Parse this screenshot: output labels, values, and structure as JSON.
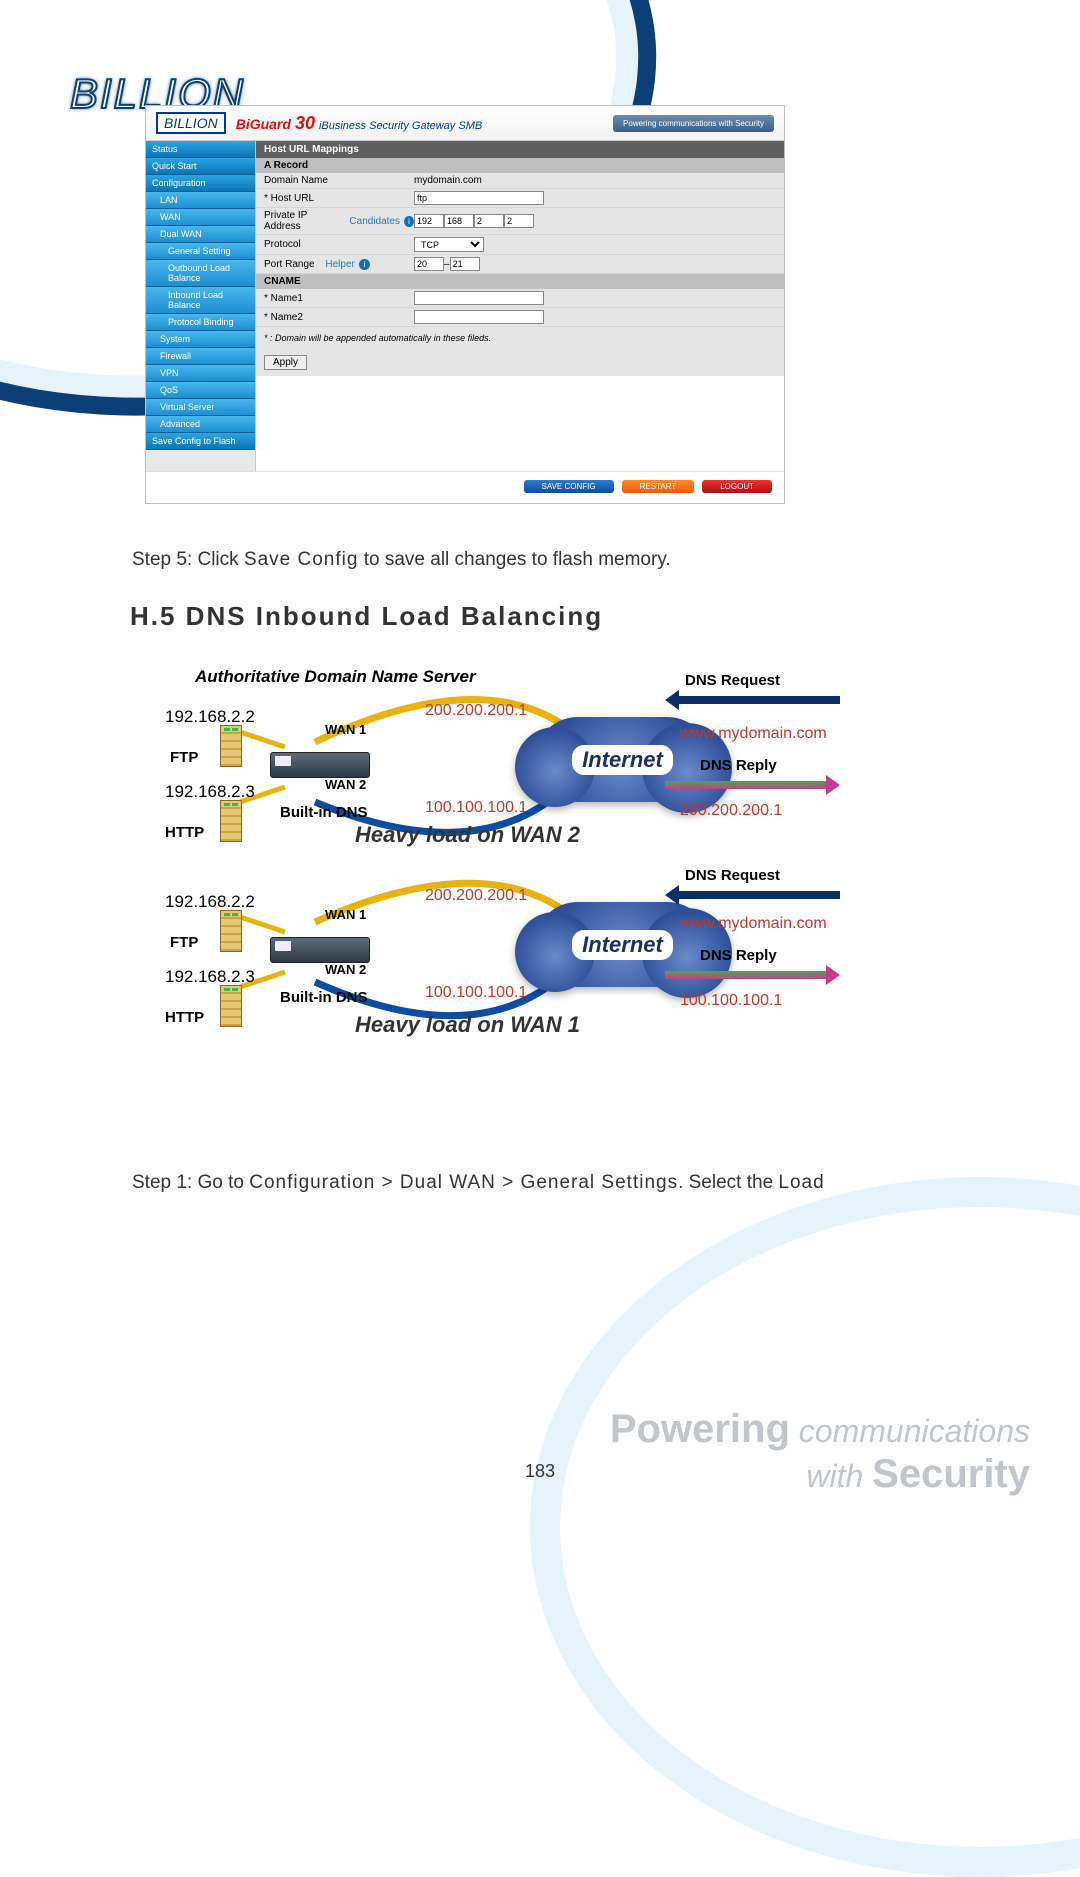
{
  "brand": "BILLION",
  "footer_tag_line1": "Powering",
  "footer_tag_line1b": "communications",
  "footer_tag_line2a": "with",
  "footer_tag_line2b": "Security",
  "page_number": "183",
  "admin": {
    "logo": "BILLION",
    "product_bg": "BiGuard",
    "product_num": "30",
    "product_sub": "iBusiness Security Gateway SMB",
    "header_tag": "Powering communications with Security",
    "nav": [
      {
        "label": "Status"
      },
      {
        "label": "Quick Start"
      },
      {
        "label": "Configuration"
      },
      {
        "label": "LAN",
        "sub": true
      },
      {
        "label": "WAN",
        "sub": true
      },
      {
        "label": "Dual WAN",
        "sub": true
      },
      {
        "label": "General Setting",
        "sub": true,
        "deep": true
      },
      {
        "label": "Outbound Load Balance",
        "sub": true,
        "deep": true
      },
      {
        "label": "Inbound Load Balance",
        "sub": true,
        "deep": true
      },
      {
        "label": "Protocol Binding",
        "sub": true,
        "deep": true
      },
      {
        "label": "System",
        "sub": true
      },
      {
        "label": "Firewall",
        "sub": true
      },
      {
        "label": "VPN",
        "sub": true
      },
      {
        "label": "QoS",
        "sub": true
      },
      {
        "label": "Virtual Server",
        "sub": true
      },
      {
        "label": "Advanced",
        "sub": true
      },
      {
        "label": "Save Config to Flash"
      }
    ],
    "section_title": "Host URL Mappings",
    "group_a": "A Record",
    "rows": {
      "domain_lbl": "Domain Name",
      "domain_val": "mydomain.com",
      "host_lbl": "* Host URL",
      "host_val": "ftp",
      "ip_lbl": "Private IP Address",
      "ip_link": "Candidates",
      "ip_a": "192",
      "ip_b": "168",
      "ip_c": "2",
      "ip_d": "2",
      "proto_lbl": "Protocol",
      "proto_val": "TCP",
      "port_lbl": "Port Range",
      "port_link": "Helper",
      "port_a": "20",
      "port_b": "21"
    },
    "group_b": "CNAME",
    "cname1_lbl": "* Name1",
    "cname2_lbl": "* Name2",
    "note": "* : Domain will be appended automatically in these fileds.",
    "apply": "Apply",
    "footer_btns": {
      "save": "SAVE CONFIG",
      "restart": "RESTART",
      "logout": "LOGOUT"
    }
  },
  "step5_a": "Step 5: Click ",
  "step5_kw": "Save Config",
  "step5_b": " to save all changes to flash memory.",
  "section_heading": "H.5   DNS Inbound Load Balancing",
  "diagram": {
    "auth_title": "Authoritative Domain Name Server",
    "ftp": "FTP",
    "http": "HTTP",
    "wan1": "WAN 1",
    "wan2": "WAN 2",
    "builtin": "Built-in DNS",
    "internet": "Internet",
    "dns_req": "DNS Request",
    "dns_reply": "DNS Reply",
    "domain": "www.mydomain.com",
    "ip_wan1": "200.200.200.1",
    "ip_wan2": "100.100.100.1",
    "ip_lan_ftp": "192.168.2.2",
    "ip_lan_http": "192.168.2.3",
    "heavy2": "Heavy load on WAN 2",
    "heavy1": "Heavy load on WAN 1",
    "reply_ip_top": "200.200.200.1",
    "reply_ip_bot": "100.100.100.1"
  },
  "step1_a": "Step 1: Go to ",
  "step1_kw": "Configuration > Dual WAN > General Settings",
  "step1_b": ". Select the ",
  "step1_c": "Load"
}
